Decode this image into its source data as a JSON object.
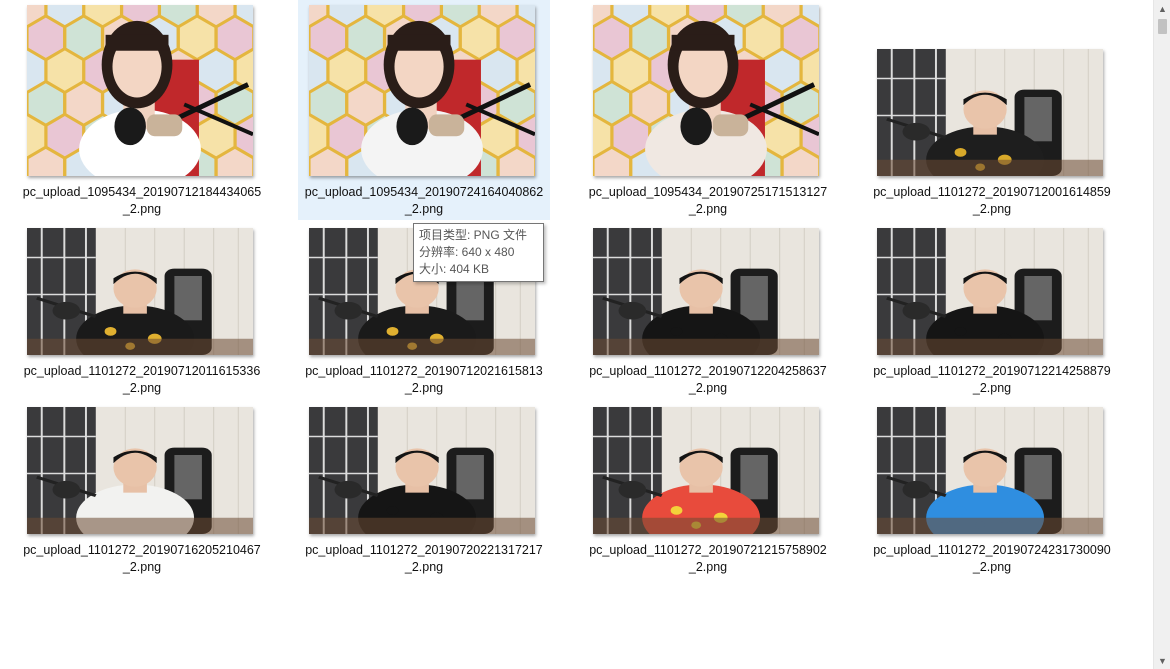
{
  "files": [
    {
      "name_line1": "pc_upload_1095434_20190712184434065",
      "name_line2": "_2.png",
      "scene": "woman-honeycomb",
      "selected": false
    },
    {
      "name_line1": "pc_upload_1095434_20190724164040862",
      "name_line2": "_2.png",
      "scene": "woman-honeycomb",
      "selected": true
    },
    {
      "name_line1": "pc_upload_1095434_20190725171513127",
      "name_line2": "_2.png",
      "scene": "woman-honeycomb",
      "selected": false
    },
    {
      "name_line1": "pc_upload_1101272_20190712001614859",
      "name_line2": "_2.png",
      "scene": "man-room-dark-shirt",
      "selected": false
    },
    {
      "name_line1": "pc_upload_1101272_20190712011615336",
      "name_line2": "_2.png",
      "scene": "man-room-print-shirt",
      "selected": false
    },
    {
      "name_line1": "pc_upload_1101272_20190712021615813",
      "name_line2": "_2.png",
      "scene": "man-room-print-shirt",
      "selected": false
    },
    {
      "name_line1": "pc_upload_1101272_20190712204258637",
      "name_line2": "_2.png",
      "scene": "man-room-black-tee",
      "selected": false
    },
    {
      "name_line1": "pc_upload_1101272_20190712214258879",
      "name_line2": "_2.png",
      "scene": "man-room-black-tee",
      "selected": false
    },
    {
      "name_line1": "pc_upload_1101272_20190716205210467",
      "name_line2": "_2.png",
      "scene": "man-room-white-tee",
      "selected": false
    },
    {
      "name_line1": "pc_upload_1101272_20190720221317217",
      "name_line2": "_2.png",
      "scene": "man-room-black-tee",
      "selected": false
    },
    {
      "name_line1": "pc_upload_1101272_20190721215758902",
      "name_line2": "_2.png",
      "scene": "man-room-colorful-shirt",
      "selected": false
    },
    {
      "name_line1": "pc_upload_1101272_20190724231730090",
      "name_line2": "_2.png",
      "scene": "man-room-blue-tee",
      "selected": false
    }
  ],
  "tooltip": {
    "type_line": "项目类型: PNG 文件",
    "resolution_line": "分辨率: 640 x 480",
    "size_line": "大小: 404 KB"
  },
  "scrollbar": {
    "up_icon": "chevron-up-icon",
    "down_icon": "chevron-down-icon"
  },
  "colors": {
    "selection": "#e5f1fb",
    "honeycomb": "#e9c14a",
    "room_wall": "#e8e4dc",
    "chair": "#1a1a1a"
  }
}
